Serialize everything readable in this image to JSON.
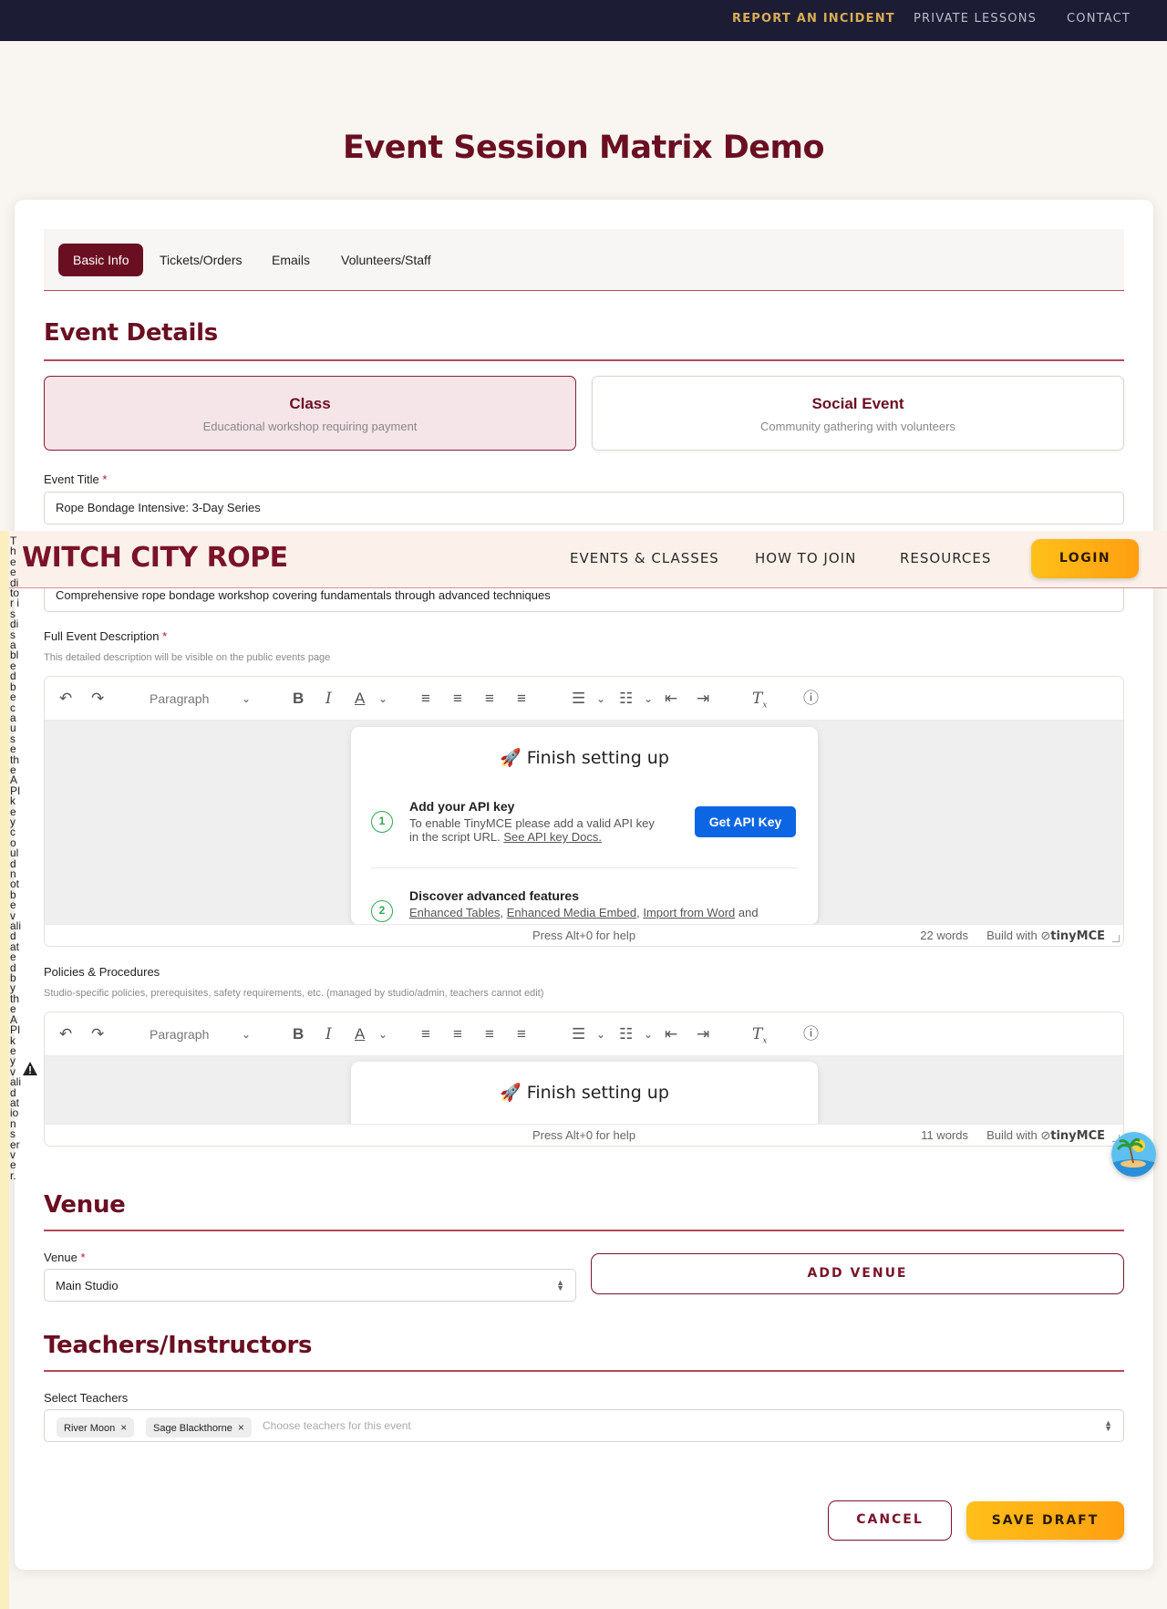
{
  "utility_nav": {
    "report": "REPORT AN INCIDENT",
    "lessons": "PRIVATE LESSONS",
    "contact": "CONTACT"
  },
  "page": {
    "title": "Event Session Matrix Demo"
  },
  "tabs": [
    {
      "label": "Basic Info",
      "active": true
    },
    {
      "label": "Tickets/Orders"
    },
    {
      "label": "Emails"
    },
    {
      "label": "Volunteers/Staff"
    }
  ],
  "event_details": {
    "heading": "Event Details",
    "types": [
      {
        "title": "Class",
        "subtitle": "Educational workshop requiring payment",
        "selected": true
      },
      {
        "title": "Social Event",
        "subtitle": "Community gathering with volunteers",
        "selected": false
      }
    ],
    "title_label": "Event Title",
    "title_value": "Rope Bondage Intensive: 3-Day Series",
    "short_desc_value": "Comprehensive rope bondage workshop covering fundamentals through advanced techniques",
    "required_mark": "*"
  },
  "site_nav": {
    "brand": "WITCH CITY ROPE",
    "events": "EVENTS & CLASSES",
    "join": "HOW TO JOIN",
    "resources": "RESOURCES",
    "login": "LOGIN"
  },
  "full_description": {
    "label": "Full Event Description",
    "hint": "This detailed description will be visible on the public events page",
    "word_count": "22 words"
  },
  "editor_toolbar": {
    "block_format": "Paragraph"
  },
  "editor_status": {
    "help": "Press Alt+0 for help",
    "build_with": "Build with",
    "brand": "tinyMCE"
  },
  "setup_card": {
    "title": "🚀 Finish setting up",
    "step1_num": "1",
    "step1_title": "Add your API key",
    "step1_text_a": "To enable TinyMCE please add a valid API key",
    "step1_text_b": "in the script URL.",
    "step1_link": "See API key Docs.",
    "api_button": "Get API Key",
    "step2_num": "2",
    "step2_title": "Discover advanced features",
    "step2_link1": "Enhanced Tables",
    "step2_link2": "Enhanced Media Embed",
    "step2_link3": "Import from Word",
    "step2_tail": "and"
  },
  "policies": {
    "label": "Policies & Procedures",
    "hint": "Studio-specific policies, prerequisites, safety requirements, etc. (managed by studio/admin, teachers cannot edit)",
    "word_count": "11 words"
  },
  "venue": {
    "heading": "Venue",
    "label": "Venue",
    "selected": "Main Studio",
    "add_button": "ADD VENUE"
  },
  "teachers": {
    "heading": "Teachers/Instructors",
    "label": "Select Teachers",
    "chips": [
      "River Moon",
      "Sage Blackthorne"
    ],
    "chip_remove": "×",
    "placeholder": "Choose teachers for this event"
  },
  "actions": {
    "cancel": "CANCEL",
    "save": "SAVE DRAFT"
  },
  "error_message": "The editor is disabled because the API key could not be validated by the API key validation server.",
  "colors": {
    "brand": "#6a0f22",
    "accent": "#ffb014",
    "nav_dark": "#1d1c35",
    "tinymce_blue": "#0c66e4"
  }
}
